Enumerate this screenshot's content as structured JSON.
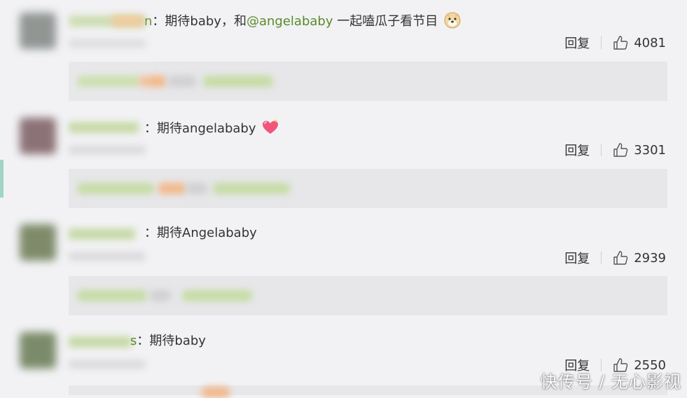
{
  "comments": [
    {
      "name_suffix": "n",
      "prefix": "：期待baby，和",
      "mention": "@angelababy",
      "suffix": " 一起嗑瓜子看节目",
      "emoji": "doge-emoji",
      "reply_label": "回复",
      "likes": "4081"
    },
    {
      "prefix": "：期待angelababy",
      "emoji": "heart-emoji",
      "reply_label": "回复",
      "likes": "3301"
    },
    {
      "prefix": "：期待Angelababy",
      "reply_label": "回复",
      "likes": "2939"
    },
    {
      "name_suffix": "s",
      "prefix": "：期待baby",
      "reply_label": "回复",
      "likes": "2550"
    }
  ],
  "watermark": "快传号 / 无心影视",
  "colors": {
    "background": "#f2f2f5",
    "mention": "#5b8a2a",
    "reply_box": "#e7e7ea",
    "text": "#333333"
  },
  "icons": [
    "thumbs-up-icon",
    "doge-emoji",
    "heart-emoji"
  ]
}
